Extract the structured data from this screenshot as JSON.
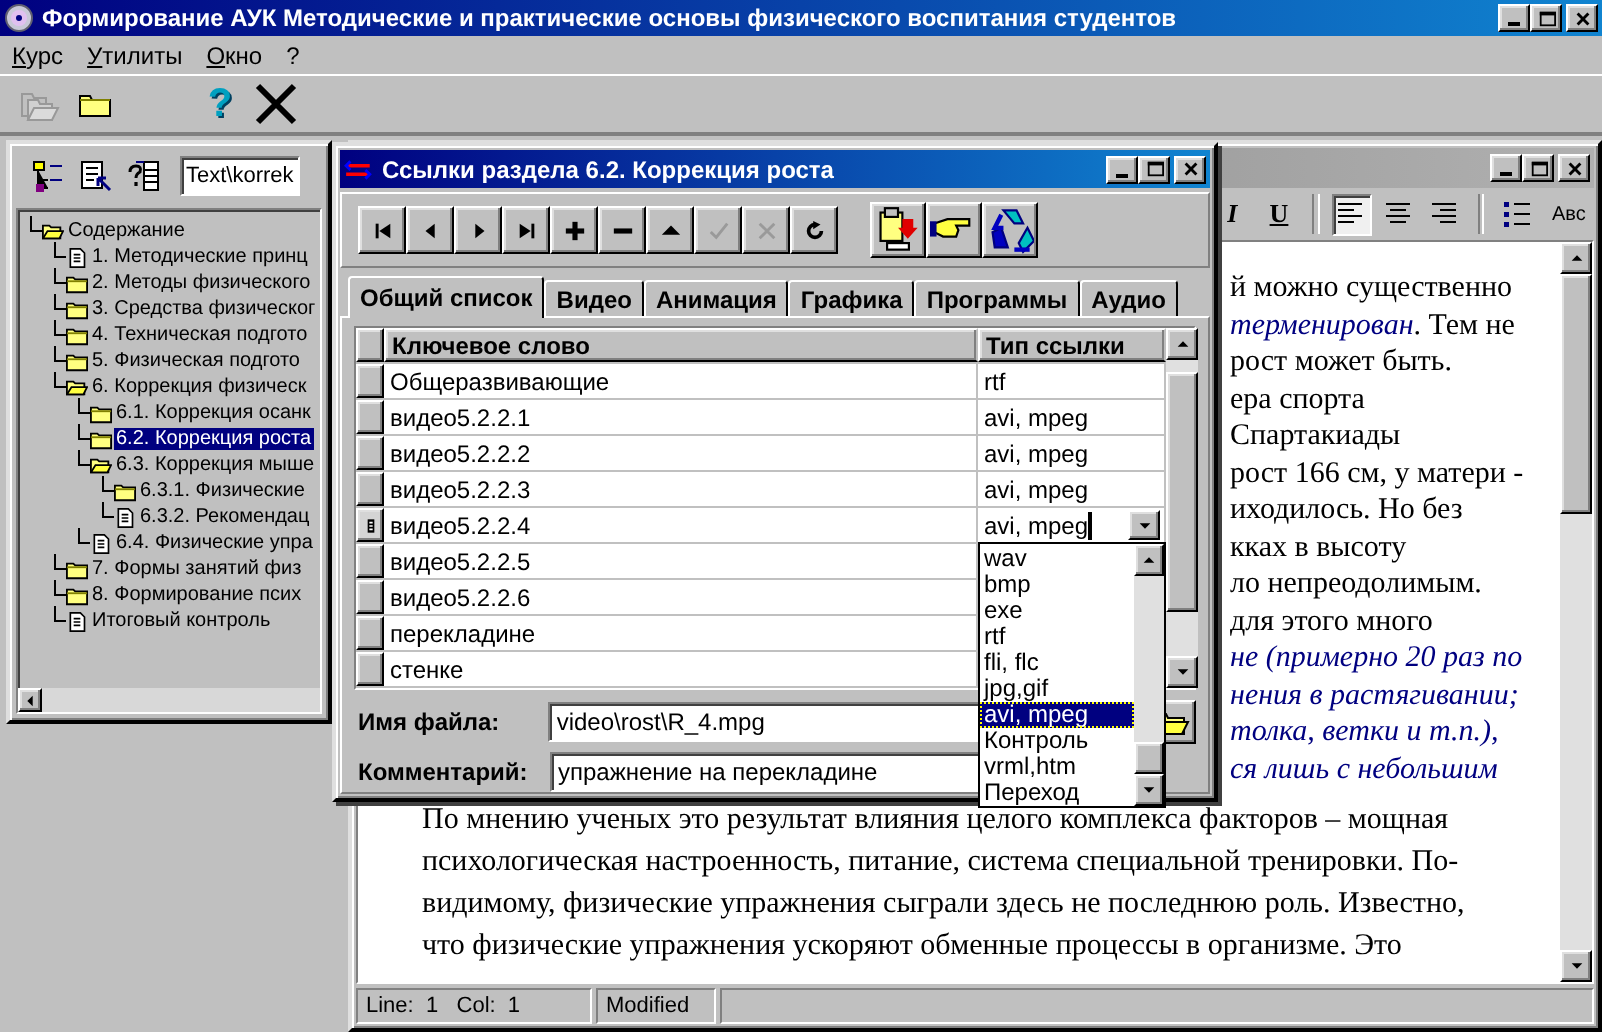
{
  "main_window": {
    "title": "Формирование АУК  Методические и практические основы физического воспитания студентов"
  },
  "menu": [
    {
      "label": "Курс"
    },
    {
      "label": "Утилиты"
    },
    {
      "label": "Окно"
    },
    {
      "label": "?"
    }
  ],
  "toolbar": [
    {
      "kind": "files",
      "disabled": true
    },
    {
      "kind": "folder",
      "disabled": false
    },
    {
      "kind": "help",
      "label": "?",
      "disabled": false
    },
    {
      "kind": "exit",
      "disabled": false
    }
  ],
  "tree_window": {
    "path_field": "Text\\korrek",
    "tree": [
      {
        "label": "Содержание",
        "kind": "folder",
        "expanded": true,
        "selected": false,
        "children": [
          {
            "label": "1. Методические принц",
            "kind": "document",
            "selected": false
          },
          {
            "label": "2. Методы физического",
            "kind": "folder",
            "expanded": false,
            "selected": false
          },
          {
            "label": "3. Средства физическог",
            "kind": "folder",
            "expanded": false,
            "selected": false
          },
          {
            "label": "4. Техническая подгото",
            "kind": "folder",
            "expanded": false,
            "selected": false
          },
          {
            "label": "5. Физическая подгото",
            "kind": "folder",
            "expanded": false,
            "selected": false
          },
          {
            "label": "6. Коррекция физическ",
            "kind": "folder",
            "expanded": true,
            "selected": false,
            "children": [
              {
                "label": "6.1. Коррекция осанк",
                "kind": "folder",
                "expanded": false,
                "selected": false
              },
              {
                "label": "6.2. Коррекция роста",
                "kind": "folder",
                "expanded": false,
                "selected": true
              },
              {
                "label": "6.3. Коррекция мыше",
                "kind": "folder",
                "expanded": true,
                "selected": false,
                "children": [
                  {
                    "label": "6.3.1. Физические",
                    "kind": "folder",
                    "expanded": false,
                    "selected": false
                  },
                  {
                    "label": "6.3.2. Рекомендац",
                    "kind": "document",
                    "selected": false
                  }
                ]
              },
              {
                "label": "6.4. Физические упра",
                "kind": "document",
                "selected": false
              }
            ]
          },
          {
            "label": "7. Формы занятий физ",
            "kind": "folder",
            "expanded": false,
            "selected": false
          },
          {
            "label": "8. Формирование псих",
            "kind": "folder",
            "expanded": false,
            "selected": false
          },
          {
            "label": "Итоговый контроль",
            "kind": "document",
            "selected": false
          }
        ]
      }
    ]
  },
  "dialog": {
    "title": "Ссылки раздела 6.2. Коррекция роста",
    "nav_buttons": [
      {
        "kind": "first",
        "disabled": false
      },
      {
        "kind": "prior",
        "disabled": false
      },
      {
        "kind": "next",
        "disabled": false
      },
      {
        "kind": "last",
        "disabled": false
      },
      {
        "kind": "insert",
        "disabled": false
      },
      {
        "kind": "delete",
        "disabled": false
      },
      {
        "kind": "edit",
        "disabled": false
      },
      {
        "kind": "post",
        "disabled": true
      },
      {
        "kind": "cancel",
        "disabled": true
      },
      {
        "kind": "refresh",
        "disabled": false
      }
    ],
    "tool_buttons": [
      {
        "kind": "import"
      },
      {
        "kind": "pointer"
      },
      {
        "kind": "recycle"
      }
    ],
    "tabs": [
      {
        "label": "Общий список",
        "selected": true
      },
      {
        "label": "Видео",
        "selected": false
      },
      {
        "label": "Анимация",
        "selected": false
      },
      {
        "label": "Графика",
        "selected": false
      },
      {
        "label": "Программы",
        "selected": false
      },
      {
        "label": "Аудио",
        "selected": false
      }
    ],
    "columns": [
      "Ключевое слово",
      "Тип ссылки"
    ],
    "rows": [
      {
        "keyword": "Общеразвивающие",
        "type": "rtf",
        "selected": false
      },
      {
        "keyword": "видео5.2.2.1",
        "type": "avi, mpeg",
        "selected": false
      },
      {
        "keyword": "видео5.2.2.2",
        "type": "avi, mpeg",
        "selected": false
      },
      {
        "keyword": "видео5.2.2.3",
        "type": "avi, mpeg",
        "selected": false
      },
      {
        "keyword": "видео5.2.2.4",
        "type": "avi, mpeg",
        "selected": true
      },
      {
        "keyword": "видео5.2.2.5",
        "type": "",
        "selected": false
      },
      {
        "keyword": "видео5.2.2.6",
        "type": "",
        "selected": false
      },
      {
        "keyword": "перекладине",
        "type": "",
        "selected": false
      },
      {
        "keyword": "стенке",
        "type": "",
        "selected": false
      }
    ],
    "dropdown": [
      {
        "label": "wav",
        "selected": false
      },
      {
        "label": "bmp",
        "selected": false
      },
      {
        "label": "exe",
        "selected": false
      },
      {
        "label": "rtf",
        "selected": false
      },
      {
        "label": "fli, flc",
        "selected": false
      },
      {
        "label": "jpg,gif",
        "selected": false
      },
      {
        "label": "avi, mpeg",
        "selected": true
      },
      {
        "label": "Контроль",
        "selected": false
      },
      {
        "label": "vrml,htm",
        "selected": false
      },
      {
        "label": "Переход",
        "selected": false
      }
    ],
    "file_name": {
      "label": "Имя файла:",
      "value": "video\\rost\\R_4.mpg"
    },
    "comment": {
      "label": "Комментарий:",
      "value": "упражнение на перекладине"
    }
  },
  "text_window": {
    "toolbar": [
      {
        "kind": "italic",
        "label": "I"
      },
      {
        "kind": "underline",
        "label": "U"
      },
      {
        "kind": "align-left",
        "on": true
      },
      {
        "kind": "align-center",
        "on": false
      },
      {
        "kind": "align-right",
        "on": false
      },
      {
        "kind": "list",
        "on": false
      },
      {
        "kind": "spell",
        "label": "Авс"
      }
    ],
    "upper_lines": [
      {
        "text": "й можно существенно",
        "kind": "plain"
      },
      {
        "text": "*терменирован*. Тем не",
        "kind": "plain"
      },
      {
        "text": "рост может быть.",
        "kind": "plain"
      },
      {
        "text": "ера спорта",
        "kind": "plain"
      },
      {
        "text": "Спартакиады",
        "kind": "plain"
      },
      {
        "text": "рост 166 см, у матери -",
        "kind": "plain"
      },
      {
        "text": "иходилось. Но без",
        "kind": "plain"
      },
      {
        "text": "кках в высоту",
        "kind": "plain"
      },
      {
        "text": "ло непреодолимым.",
        "kind": "plain"
      },
      {
        "text": "для этого много",
        "kind": "plain"
      },
      {
        "text": "не (примерно 20 раз по",
        "kind": "emphasis"
      },
      {
        "text": "нения в растягивании;",
        "kind": "emphasis"
      },
      {
        "text": "толка, ветки и т.п.),",
        "kind": "emphasis"
      },
      {
        "text": "ся лишь с небольшим",
        "kind": "emphasis"
      }
    ],
    "paragraph": [
      "По мнению ученых это результат влияния целого комплекса факторов – мощная",
      "психологическая настроенность, питание, система специальной тренировки. По-",
      "видимому, физические упражнения сыграли здесь не последнюю роль. Известно,",
      "что физические упражнения ускоряют обменные процессы в организме. Это"
    ],
    "status": [
      "Line:  1   Col:  1",
      "Modified"
    ]
  }
}
